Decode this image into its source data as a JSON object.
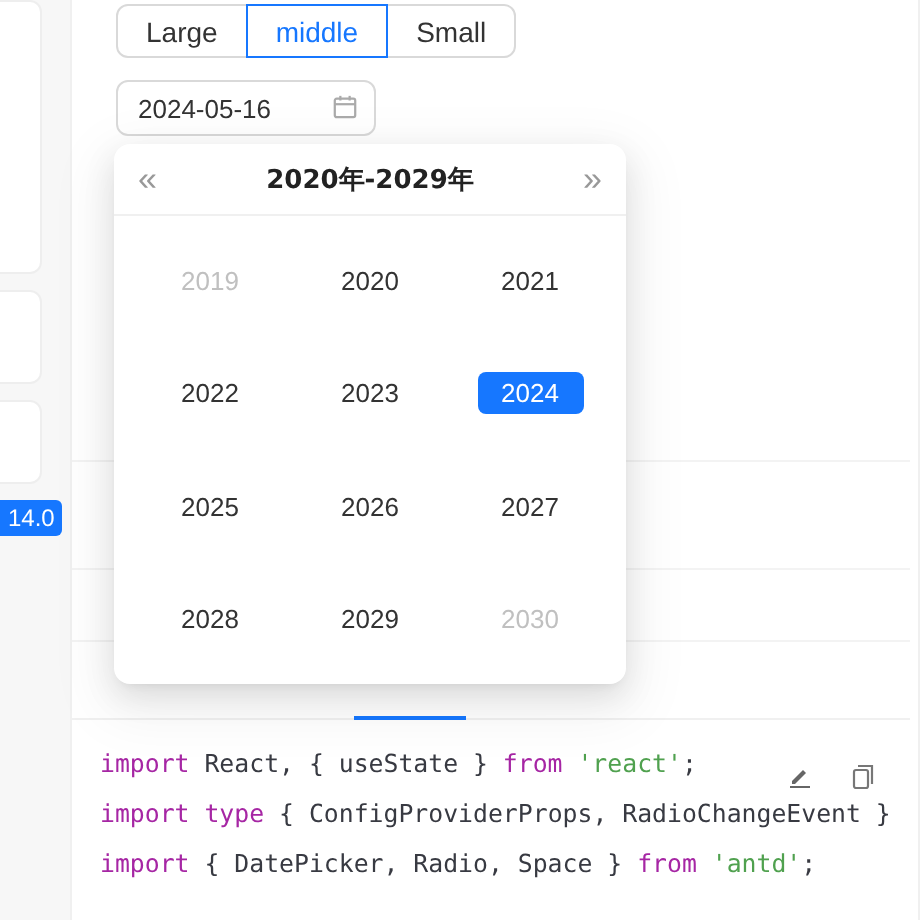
{
  "size_options": [
    {
      "label": "Large",
      "selected": false
    },
    {
      "label": "middle",
      "selected": true
    },
    {
      "label": "Small",
      "selected": false
    }
  ],
  "date_field": {
    "value": "2024-05-16"
  },
  "badge": "14.0",
  "picker": {
    "prev": "«",
    "next": "»",
    "title": "2020年-2029年",
    "years": [
      {
        "label": "2019",
        "selected": false,
        "outside": true
      },
      {
        "label": "2020",
        "selected": false,
        "outside": false
      },
      {
        "label": "2021",
        "selected": false,
        "outside": false
      },
      {
        "label": "2022",
        "selected": false,
        "outside": false
      },
      {
        "label": "2023",
        "selected": false,
        "outside": false
      },
      {
        "label": "2024",
        "selected": true,
        "outside": false
      },
      {
        "label": "2025",
        "selected": false,
        "outside": false
      },
      {
        "label": "2026",
        "selected": false,
        "outside": false
      },
      {
        "label": "2027",
        "selected": false,
        "outside": false
      },
      {
        "label": "2028",
        "selected": false,
        "outside": false
      },
      {
        "label": "2029",
        "selected": false,
        "outside": false
      },
      {
        "label": "2030",
        "selected": false,
        "outside": true
      }
    ]
  },
  "code_lines": [
    [
      {
        "kind": "keyword",
        "text": "import"
      },
      {
        "kind": "plain",
        "text": " React, { useState } "
      },
      {
        "kind": "keyword",
        "text": "from"
      },
      {
        "kind": "string",
        "text": " 'react'"
      },
      {
        "kind": "plain",
        "text": ";"
      }
    ],
    [
      {
        "kind": "keyword",
        "text": "import"
      },
      {
        "kind": "keyword",
        "text": " type"
      },
      {
        "kind": "plain",
        "text": " { ConfigProviderProps, RadioChangeEvent }"
      }
    ],
    [
      {
        "kind": "keyword",
        "text": "import"
      },
      {
        "kind": "plain",
        "text": " { DatePicker, Radio, Space } "
      },
      {
        "kind": "keyword",
        "text": "from"
      },
      {
        "kind": "string",
        "text": " 'antd'"
      },
      {
        "kind": "plain",
        "text": ";"
      }
    ]
  ]
}
